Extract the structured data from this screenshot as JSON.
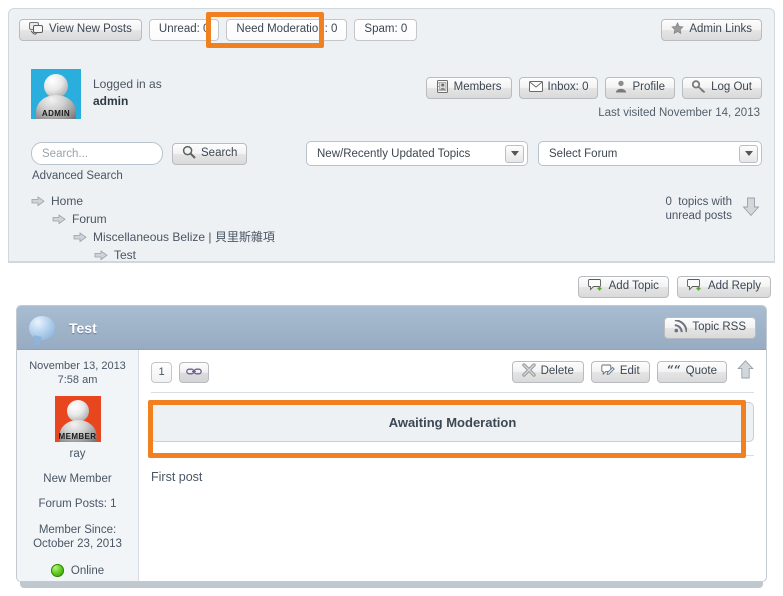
{
  "colors": {
    "annotation": "#f08020",
    "admin_avatar_bg": "#2aaede",
    "member_avatar_bg": "#e8461e",
    "topic_header": "#9fb3c9",
    "online_green": "#5fcc24"
  },
  "tabs": [
    {
      "label": "View New Posts",
      "icon": "new-posts-icon",
      "highlighted": false
    },
    {
      "label": "Unread: 0",
      "icon": "",
      "highlighted": false
    },
    {
      "label": "Need Moderation: 0",
      "icon": "",
      "highlighted": true
    },
    {
      "label": "Spam: 0",
      "icon": "",
      "highlighted": false
    }
  ],
  "admin_links": {
    "label": "Admin Links",
    "icon": "star-icon"
  },
  "user": {
    "logged_in_label": "Logged in as",
    "username": "admin",
    "avatar_tag": "ADMIN",
    "last_visited": "Last visited November 14, 2013"
  },
  "account_buttons": [
    {
      "label": "Members",
      "icon": "members-icon"
    },
    {
      "label": "Inbox: 0",
      "icon": "envelope-icon"
    },
    {
      "label": "Profile",
      "icon": "profile-icon"
    },
    {
      "label": "Log Out",
      "icon": "key-icon"
    }
  ],
  "search": {
    "placeholder": "Search...",
    "value": "",
    "button_label": "Search",
    "advanced_label": "Advanced Search"
  },
  "selects": {
    "topics": {
      "value": "New/Recently Updated Topics"
    },
    "forum": {
      "value": "Select Forum"
    }
  },
  "breadcrumbs": [
    {
      "label": "Home",
      "indent": 0
    },
    {
      "label": "Forum",
      "indent": 1
    },
    {
      "label": "Miscellaneous Belize | 貝里斯雜項",
      "indent": 2
    },
    {
      "label": "Test",
      "indent": 3
    }
  ],
  "unread": {
    "count": "0",
    "line1": "topics with",
    "line2": "unread posts"
  },
  "topic_actions": [
    {
      "label": "Add Topic",
      "icon": "comment-add-icon"
    },
    {
      "label": "Add Reply",
      "icon": "comment-add-icon"
    }
  ],
  "topic": {
    "title": "Test",
    "rss_label": "Topic RSS",
    "rss_icon": "rss-icon"
  },
  "post": {
    "date": "November 13, 2013",
    "time": "7:58 am",
    "author": "ray",
    "avatar_tag": "MEMBER",
    "rank": "New Member",
    "forum_posts": "Forum Posts: 1",
    "member_since_label": "Member Since:",
    "member_since_date": "October 23, 2013",
    "online_status": "Online",
    "number": "1",
    "permalink_icon": "link-icon",
    "tools": [
      {
        "label": "Delete",
        "icon": "delete-icon"
      },
      {
        "label": "Edit",
        "icon": "edit-icon"
      },
      {
        "label": "Quote",
        "icon": "quote-icon"
      }
    ],
    "up_icon": "up-arrow-icon",
    "moderation_notice": "Awaiting Moderation",
    "body": "First post"
  }
}
